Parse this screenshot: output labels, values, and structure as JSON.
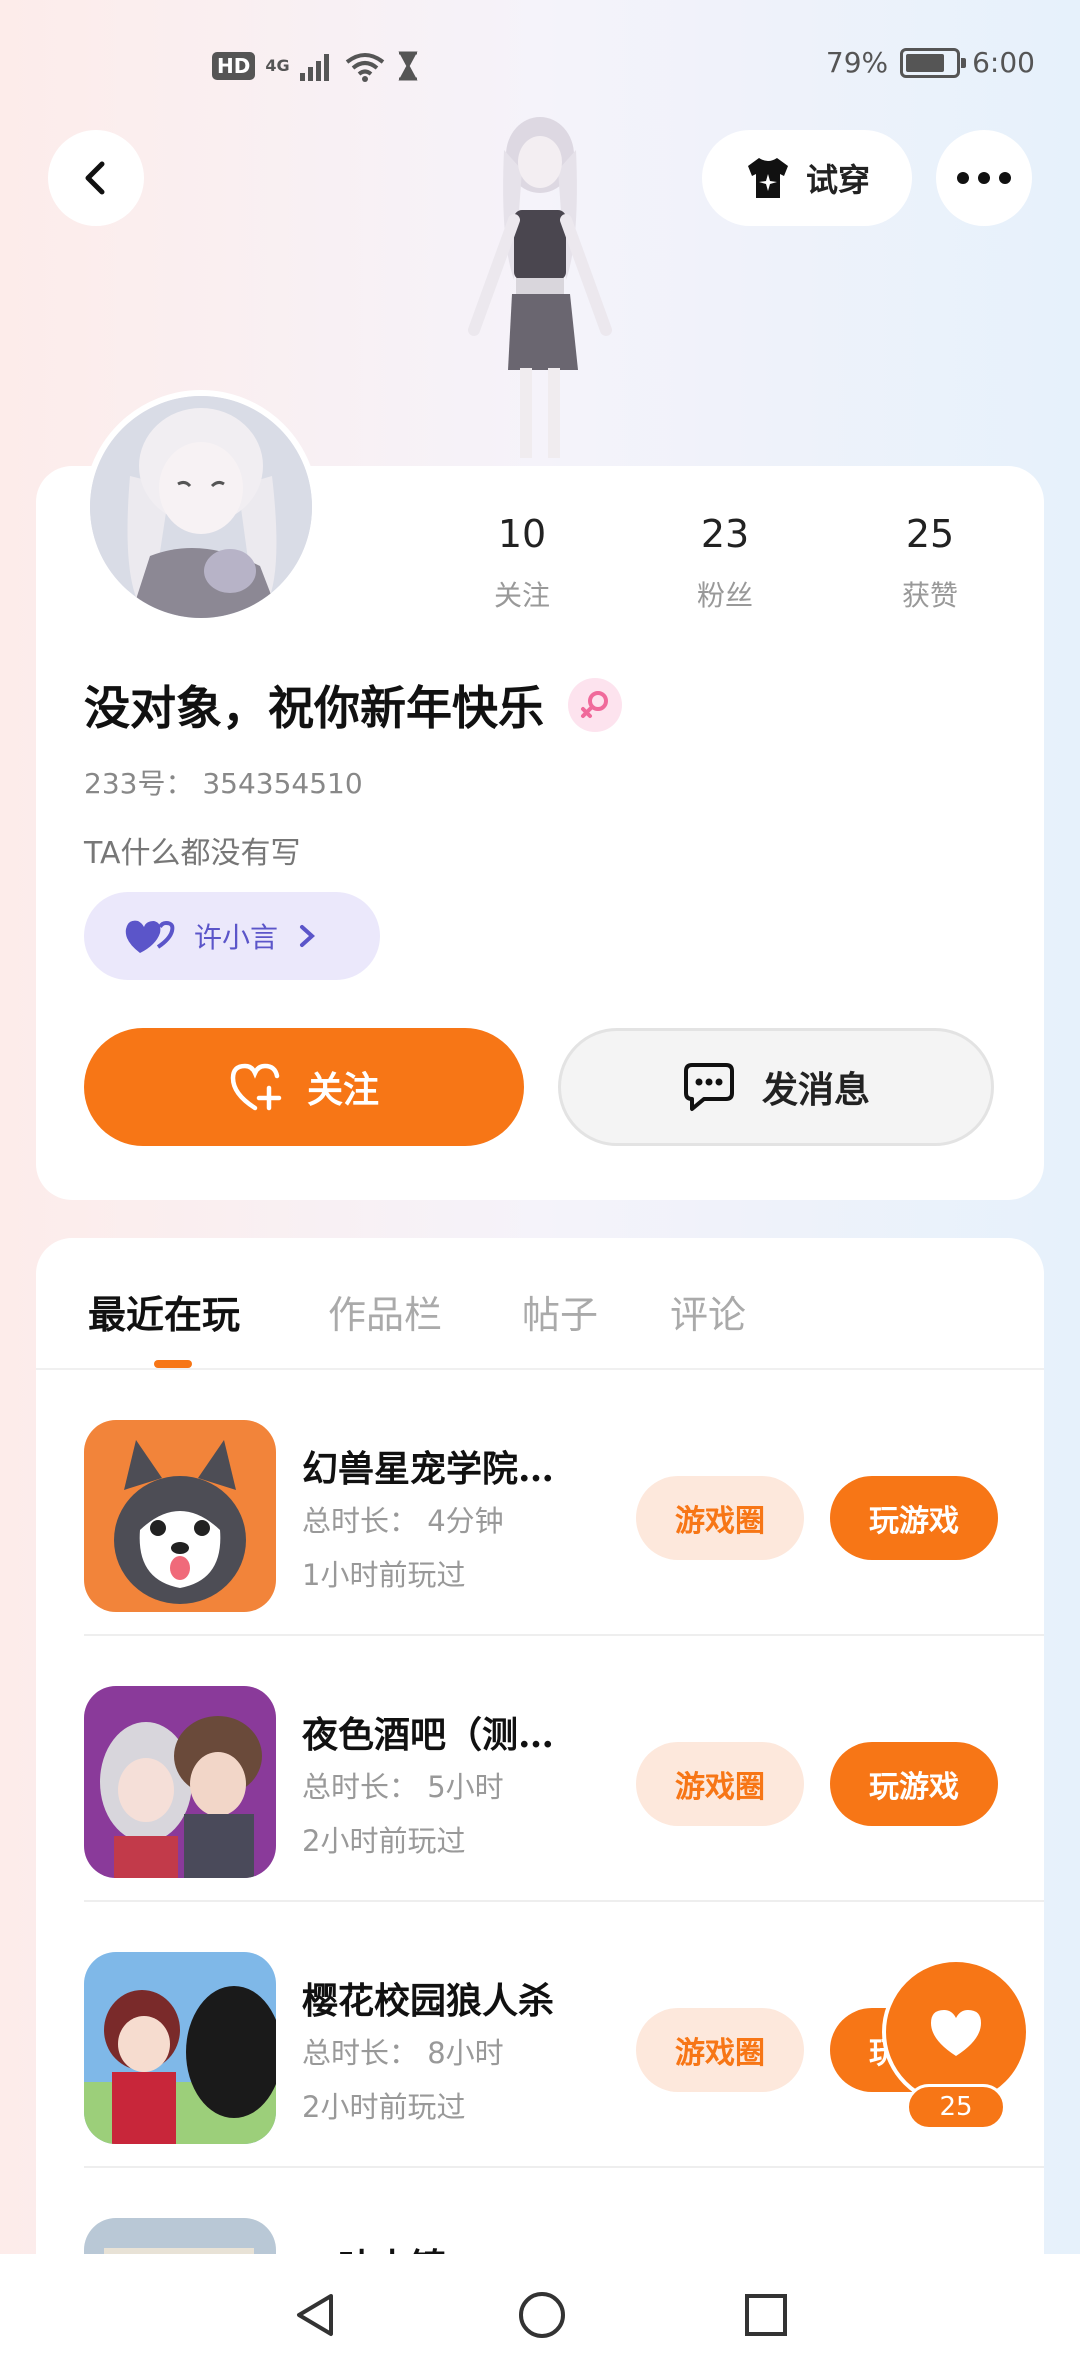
{
  "status_bar": {
    "hd": "HD",
    "network": "4G",
    "wifi_label": "6",
    "battery_percent": "79%",
    "battery_level": 0.79,
    "time": "6:00"
  },
  "header": {
    "back_icon": "chevron-left-icon",
    "tryon_label": "试穿",
    "more_icon": "more-icon"
  },
  "profile": {
    "stats": [
      {
        "num": "10",
        "label": "关注"
      },
      {
        "num": "23",
        "label": "粉丝"
      },
      {
        "num": "25",
        "label": "获赞"
      }
    ],
    "username": "没对象，祝你新年快乐",
    "uid": "233号： 354354510",
    "bio": "TA什么都没有写",
    "intimacy_label": "许小言",
    "follow_label": "关注",
    "message_label": "发消息"
  },
  "tabs": [
    {
      "label": "最近在玩",
      "active": true
    },
    {
      "label": "作品栏",
      "active": false
    },
    {
      "label": "帖子",
      "active": false
    },
    {
      "label": "评论",
      "active": false
    }
  ],
  "games": [
    {
      "name": "幻兽星宠学院…",
      "duration": "总时长： 4分钟",
      "last_played": "1小时前玩过",
      "circle_label": "游戏圈",
      "play_label": "玩游戏"
    },
    {
      "name": "夜色酒吧（测…",
      "duration": "总时长： 5小时",
      "last_played": "2小时前玩过",
      "circle_label": "游戏圈",
      "play_label": "玩游戏"
    },
    {
      "name": "樱花校园狼人杀",
      "duration": "总时长： 8小时",
      "last_played": "2小时前玩过",
      "circle_label": "游戏圈",
      "play_label": "玩游戏"
    },
    {
      "name": "一叶小镇",
      "duration": "",
      "last_played": "",
      "circle_label": "",
      "play_label": ""
    }
  ],
  "floating_like": {
    "count": "25"
  },
  "colors": {
    "accent": "#f77616",
    "accent_light": "#fde8dc",
    "intimacy": "#5b55c9"
  }
}
